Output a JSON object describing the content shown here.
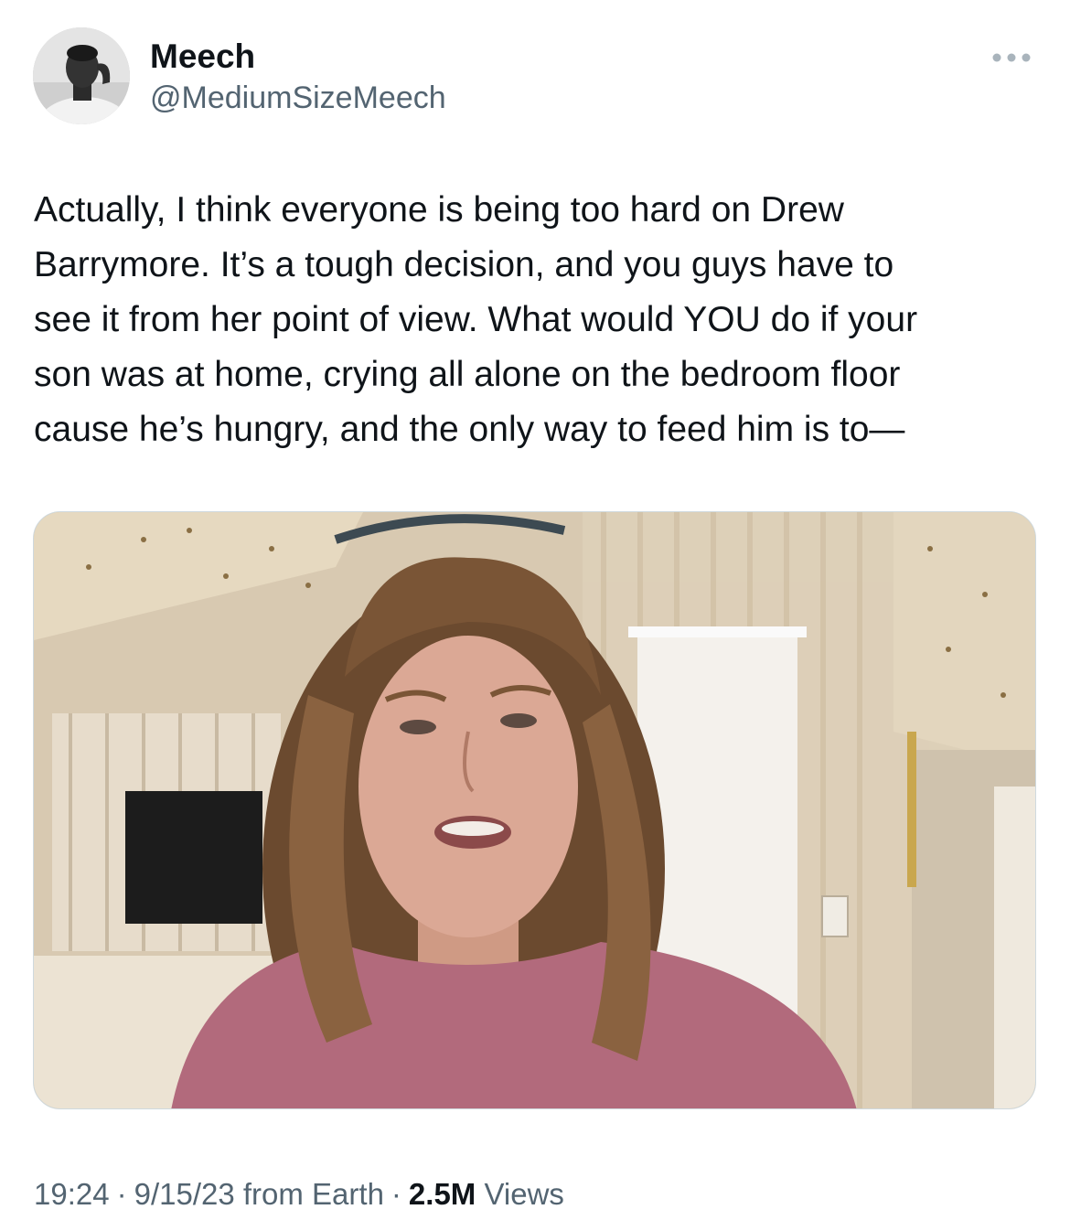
{
  "tweet": {
    "author": {
      "display_name": "Meech",
      "handle": "@MediumSizeMeech",
      "avatar_icon": "profile-photo"
    },
    "more_icon": "more-horizontal-icon",
    "text": "Actually, I think everyone is being too hard on Drew\nBarrymore. It’s a tough decision, and you guys have to\nsee it from her point of view. What would YOU do if your\nson was at home, crying all alone on the bedroom floor\ncause he’s hungry, and the only way to feed him is to—",
    "media": {
      "type": "video-still"
    },
    "meta": {
      "time": "19:24",
      "separator": "·",
      "date": "9/15/23",
      "source": "from Earth",
      "views_count": "2.5M",
      "views_label": "Views"
    }
  },
  "colors": {
    "primary_text": "#0f1419",
    "secondary_text": "#536471",
    "border": "#cfd9de",
    "background": "#ffffff"
  }
}
